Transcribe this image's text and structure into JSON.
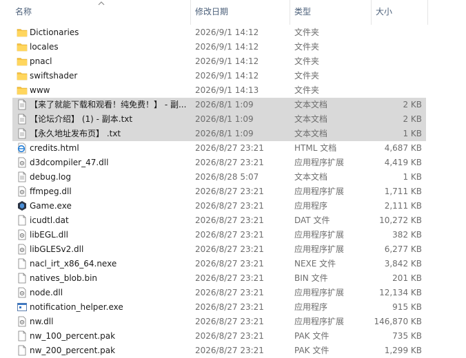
{
  "columns": {
    "name": "名称",
    "date": "修改日期",
    "type": "类型",
    "size": "大小"
  },
  "files": [
    {
      "name": "Dictionaries",
      "date": "2026/9/1 14:12",
      "type": "文件夹",
      "size": "",
      "icon": "folder-icon",
      "selected": false
    },
    {
      "name": "locales",
      "date": "2026/9/1 14:12",
      "type": "文件夹",
      "size": "",
      "icon": "folder-icon",
      "selected": false
    },
    {
      "name": "pnacl",
      "date": "2026/9/1 14:12",
      "type": "文件夹",
      "size": "",
      "icon": "folder-icon",
      "selected": false
    },
    {
      "name": "swiftshader",
      "date": "2026/9/1 14:12",
      "type": "文件夹",
      "size": "",
      "icon": "folder-icon",
      "selected": false
    },
    {
      "name": "www",
      "date": "2026/9/1 14:13",
      "type": "文件夹",
      "size": "",
      "icon": "folder-icon",
      "selected": false
    },
    {
      "name": "【来了就能下载和观看！纯免费！】 - 副...",
      "date": "2026/8/1 1:09",
      "type": "文本文档",
      "size": "2 KB",
      "icon": "text-file-icon",
      "selected": true
    },
    {
      "name": "【论坛介绍】 (1) - 副本.txt",
      "date": "2026/8/1 1:09",
      "type": "文本文档",
      "size": "2 KB",
      "icon": "text-file-icon",
      "selected": true
    },
    {
      "name": "【永久地址发布页】 .txt",
      "date": "2026/8/1 1:09",
      "type": "文本文档",
      "size": "1 KB",
      "icon": "text-file-icon",
      "selected": true
    },
    {
      "name": "credits.html",
      "date": "2026/8/27 23:21",
      "type": "HTML 文档",
      "size": "4,687 KB",
      "icon": "html-file-icon",
      "selected": false
    },
    {
      "name": "d3dcompiler_47.dll",
      "date": "2026/8/27 23:21",
      "type": "应用程序扩展",
      "size": "4,419 KB",
      "icon": "dll-file-icon",
      "selected": false
    },
    {
      "name": "debug.log",
      "date": "2026/8/28 5:07",
      "type": "文本文档",
      "size": "1 KB",
      "icon": "text-file-icon",
      "selected": false
    },
    {
      "name": "ffmpeg.dll",
      "date": "2026/8/27 23:21",
      "type": "应用程序扩展",
      "size": "1,711 KB",
      "icon": "dll-file-icon",
      "selected": false
    },
    {
      "name": "Game.exe",
      "date": "2026/8/27 23:21",
      "type": "应用程序",
      "size": "2,111 KB",
      "icon": "game-exe-icon",
      "selected": false
    },
    {
      "name": "icudtl.dat",
      "date": "2026/8/27 23:21",
      "type": "DAT 文件",
      "size": "10,272 KB",
      "icon": "blank-file-icon",
      "selected": false
    },
    {
      "name": "libEGL.dll",
      "date": "2026/8/27 23:21",
      "type": "应用程序扩展",
      "size": "382 KB",
      "icon": "dll-file-icon",
      "selected": false
    },
    {
      "name": "libGLESv2.dll",
      "date": "2026/8/27 23:21",
      "type": "应用程序扩展",
      "size": "6,277 KB",
      "icon": "dll-file-icon",
      "selected": false
    },
    {
      "name": "nacl_irt_x86_64.nexe",
      "date": "2026/8/27 23:21",
      "type": "NEXE 文件",
      "size": "3,842 KB",
      "icon": "blank-file-icon",
      "selected": false
    },
    {
      "name": "natives_blob.bin",
      "date": "2026/8/27 23:21",
      "type": "BIN 文件",
      "size": "201 KB",
      "icon": "blank-file-icon",
      "selected": false
    },
    {
      "name": "node.dll",
      "date": "2026/8/27 23:21",
      "type": "应用程序扩展",
      "size": "12,134 KB",
      "icon": "dll-file-icon",
      "selected": false
    },
    {
      "name": "notification_helper.exe",
      "date": "2026/8/27 23:21",
      "type": "应用程序",
      "size": "915 KB",
      "icon": "exe-file-icon",
      "selected": false
    },
    {
      "name": "nw.dll",
      "date": "2026/8/27 23:21",
      "type": "应用程序扩展",
      "size": "146,870 KB",
      "icon": "dll-file-icon",
      "selected": false
    },
    {
      "name": "nw_100_percent.pak",
      "date": "2026/8/27 23:21",
      "type": "PAK 文件",
      "size": "735 KB",
      "icon": "blank-file-icon",
      "selected": false
    },
    {
      "name": "nw_200_percent.pak",
      "date": "2026/8/27 23:21",
      "type": "PAK 文件",
      "size": "1,299 KB",
      "icon": "blank-file-icon",
      "selected": false
    }
  ]
}
